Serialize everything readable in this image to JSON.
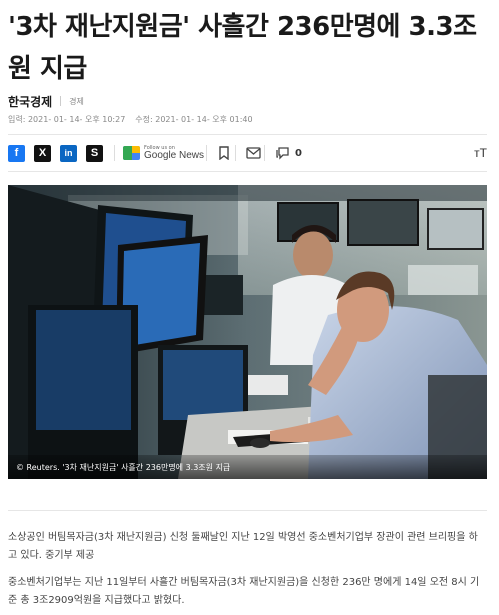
{
  "article": {
    "title": "'3차 재난지원금' 사흘간 236만명에 3.3조원 지급",
    "source": "한국경제",
    "category": "경제",
    "published": "입력: 2021- 01- 14- 오후 10:27",
    "updated": "수정: 2021- 01- 14- 오후 01:40"
  },
  "share": {
    "facebook": "f",
    "x": "X",
    "linkedin": "in",
    "other": "S",
    "google_news_small": "Follow us on",
    "google_news_label": "Google News",
    "comment_count": "0",
    "text_size": "ᴛT"
  },
  "image": {
    "caption": "© Reuters. '3차 재난지원금' 사흘간 236만명에 3.3조원 지급"
  },
  "body": {
    "paragraph1": "소상공인 버팀목자금(3차 재난지원금) 신청 둘째날인 지난 12일 박영선 중소벤처기업부 장관이 관련 브리핑을 하고 있다. 중기부 제공",
    "paragraph2": "중소벤처기업부는 지난 11일부터 사흘간 버팀목자금(3차 재난지원금)을 신청한 236만 명에게 14일 오전 8시 기준 총 3조2909억원을 지급했다고 밝혔다."
  },
  "icons": {
    "bookmark": "bookmark-icon",
    "mail": "mail-icon",
    "comment": "comment-icon",
    "google_news": "google-news-icon"
  }
}
